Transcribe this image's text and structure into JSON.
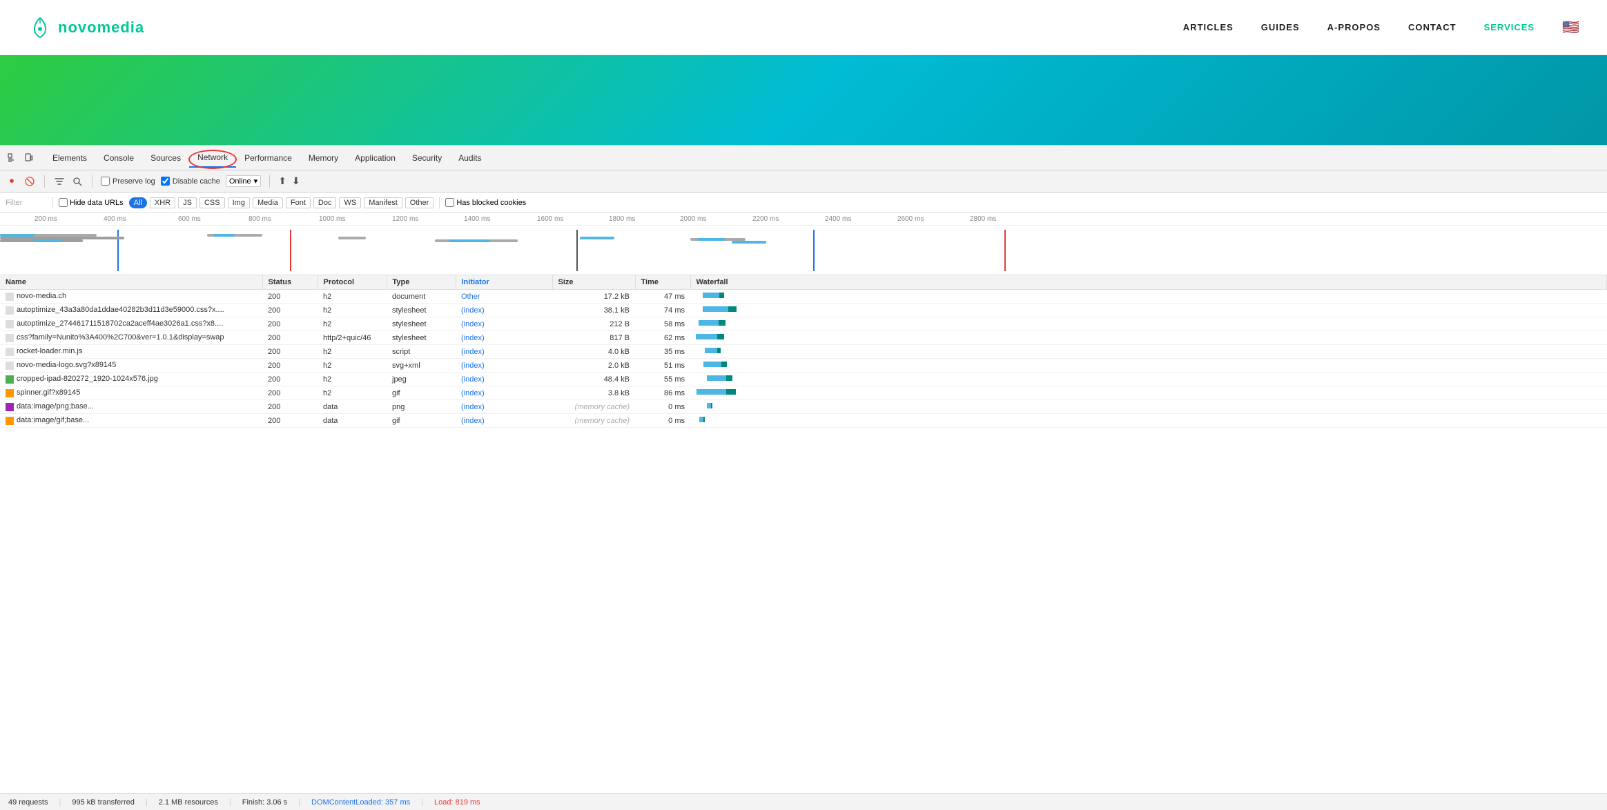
{
  "site": {
    "logo_text_1": "novo",
    "logo_text_2": "media",
    "nav": {
      "articles": "ARTICLES",
      "guides": "GUIDES",
      "apropos": "A-PROPOS",
      "contact": "CONTACT",
      "services": "SERVICES"
    }
  },
  "devtools": {
    "tabs": [
      "Elements",
      "Console",
      "Sources",
      "Network",
      "Performance",
      "Memory",
      "Application",
      "Security",
      "Audits"
    ],
    "active_tab": "Network",
    "toolbar": {
      "preserve_log": "Preserve log",
      "disable_cache": "Disable cache",
      "online": "Online"
    },
    "filter": {
      "placeholder": "Filter",
      "hide_data_urls": "Hide data URLs",
      "buttons": [
        "All",
        "XHR",
        "JS",
        "CSS",
        "Img",
        "Media",
        "Font",
        "Doc",
        "WS",
        "Manifest",
        "Other"
      ],
      "active_button": "All",
      "has_blocked": "Has blocked cookies"
    },
    "timeline": {
      "labels": [
        "200 ms",
        "400 ms",
        "600 ms",
        "800 ms",
        "1000 ms",
        "1200 ms",
        "1400 ms",
        "1600 ms",
        "1800 ms",
        "2000 ms",
        "2200 ms",
        "2400 ms",
        "2600 ms",
        "2800 ms"
      ]
    },
    "table": {
      "headers": [
        "Name",
        "Status",
        "Protocol",
        "Type",
        "Initiator",
        "Size",
        "Time",
        "Waterfall"
      ],
      "rows": [
        {
          "name": "novo-media.ch",
          "status": "200",
          "protocol": "h2",
          "type": "document",
          "initiator": "Other",
          "initiator_type": "other",
          "size": "17.2 kB",
          "time": "47 ms"
        },
        {
          "name": "autoptimize_43a3a80da1ddae40282b3d11d3e59000.css?x....",
          "status": "200",
          "protocol": "h2",
          "type": "stylesheet",
          "initiator": "(index)",
          "initiator_type": "link",
          "size": "38.1 kB",
          "time": "74 ms"
        },
        {
          "name": "autoptimize_274461711518702ca2aceff4ae3026a1.css?x8....",
          "status": "200",
          "protocol": "h2",
          "type": "stylesheet",
          "initiator": "(index)",
          "initiator_type": "link",
          "size": "212 B",
          "time": "58 ms"
        },
        {
          "name": "css?family=Nunito%3A400%2C700&ver=1.0.1&display=swap",
          "status": "200",
          "protocol": "http/2+quic/46",
          "type": "stylesheet",
          "initiator": "(index)",
          "initiator_type": "link",
          "size": "817 B",
          "time": "62 ms"
        },
        {
          "name": "rocket-loader.min.js",
          "status": "200",
          "protocol": "h2",
          "type": "script",
          "initiator": "(index)",
          "initiator_type": "link",
          "size": "4.0 kB",
          "time": "35 ms"
        },
        {
          "name": "novo-media-logo.svg?x89145",
          "status": "200",
          "protocol": "h2",
          "type": "svg+xml",
          "initiator": "(index)",
          "initiator_type": "link",
          "size": "2.0 kB",
          "time": "51 ms"
        },
        {
          "name": "cropped-ipad-820272_1920-1024x576.jpg",
          "status": "200",
          "protocol": "h2",
          "type": "jpeg",
          "initiator": "(index)",
          "initiator_type": "link",
          "size": "48.4 kB",
          "time": "55 ms",
          "icon": "img"
        },
        {
          "name": "spinner.gif?x89145",
          "status": "200",
          "protocol": "h2",
          "type": "gif",
          "initiator": "(index)",
          "initiator_type": "link",
          "size": "3.8 kB",
          "time": "86 ms",
          "icon": "gif"
        },
        {
          "name": "data:image/png;base...",
          "status": "200",
          "protocol": "data",
          "type": "png",
          "initiator": "(index)",
          "initiator_type": "link",
          "size": "(memory cache)",
          "time": "0 ms",
          "icon": "png"
        },
        {
          "name": "data:image/gif;base...",
          "status": "200",
          "protocol": "data",
          "type": "gif",
          "initiator": "(index)",
          "initiator_type": "link",
          "size": "(memory cache)",
          "time": "0 ms",
          "icon": "gif"
        }
      ]
    },
    "statusbar": {
      "requests": "49 requests",
      "transferred": "995 kB transferred",
      "resources": "2.1 MB resources",
      "finish": "Finish: 3.06 s",
      "dom_loaded": "DOMContentLoaded: 357 ms",
      "load": "Load: 819 ms"
    }
  }
}
